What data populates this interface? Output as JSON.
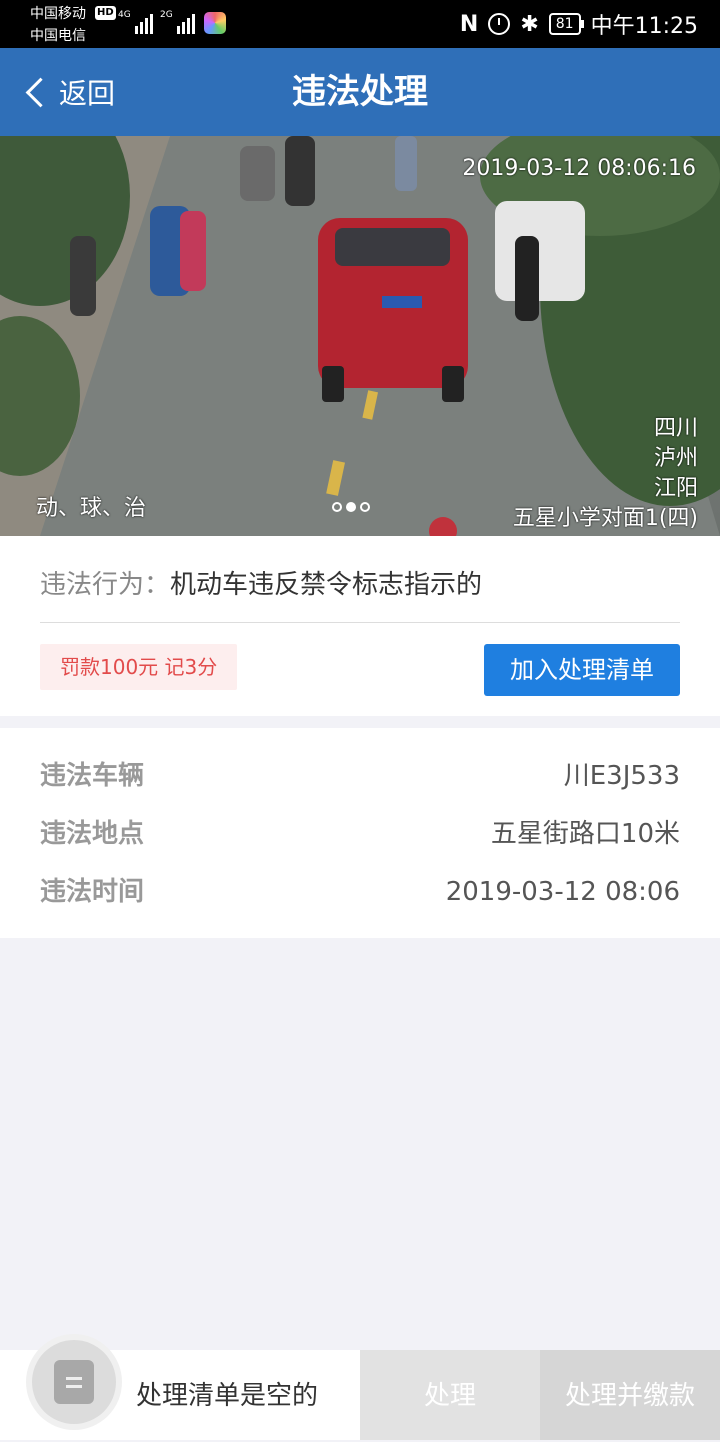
{
  "status_bar": {
    "carrier1": "中国移动",
    "carrier2": "中国电信",
    "hd": "HD",
    "net1": "4G",
    "net2": "2G",
    "battery": "81",
    "time": "中午11:25"
  },
  "nav": {
    "back_label": "返回",
    "title": "违法处理"
  },
  "photo": {
    "timestamp": "2019-03-12  08:06:16",
    "province": "四川",
    "city": "泸州",
    "district": "江阳",
    "location": "五星小学对面1(四)",
    "plate_hint": "动、球、治",
    "carousel": {
      "count": 3,
      "active_index": 1
    }
  },
  "violation": {
    "behavior_label": "违法行为：",
    "behavior_value": "机动车违反禁令标志指示的",
    "fine": "罚款100元 记3分",
    "add_button": "加入处理清单"
  },
  "details": [
    {
      "label": "违法车辆",
      "value": "川E3J533"
    },
    {
      "label": "违法地点",
      "value": "五星街路口10米"
    },
    {
      "label": "违法时间",
      "value": "2019-03-12 08:06"
    }
  ],
  "bottom": {
    "empty_text": "处理清单是空的",
    "process_button": "处理",
    "process_pay_button": "处理并缴款"
  }
}
